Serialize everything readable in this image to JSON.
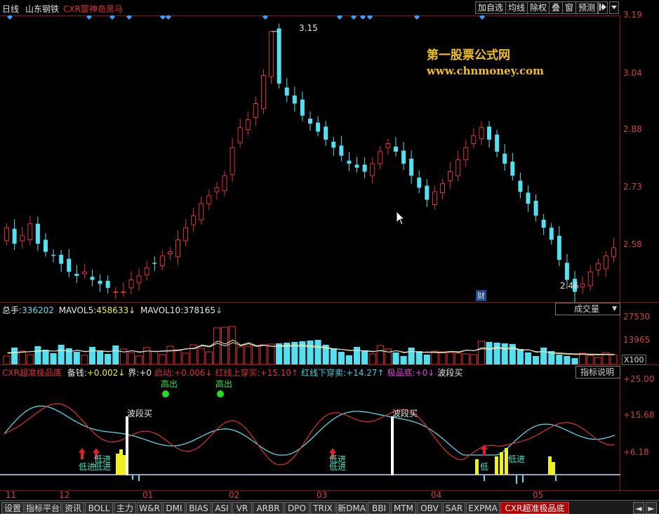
{
  "topbar": {
    "period": "日线",
    "stock_name": "山东钢铁",
    "formula_name": "CXR婴神奇黑马",
    "buttons": [
      "加自选",
      "均线",
      "除权",
      "叠",
      "窗",
      "预测"
    ],
    "nav_icon": "pipe-arrow-icon",
    "menu_icon": "menu-arrow-icon"
  },
  "watermark": {
    "title": "第一股票公式网",
    "url": "www.chnmoney.com"
  },
  "price_axis": [
    "3.19",
    "3.04",
    "2.88",
    "2.73",
    "2.58"
  ],
  "price_annotations": {
    "high": "3.15",
    "low": "2.46",
    "badge": "财"
  },
  "volume": {
    "label_total": "总手:",
    "total": "336202",
    "label_ma5": "MAVOL5:",
    "ma5": "458633",
    "label_ma10": "MAVOL10:",
    "ma10": "378165",
    "arrow": "↓",
    "selector": "成交量",
    "axis": [
      "27530",
      "13965"
    ],
    "multiplier": "X100"
  },
  "indicator": {
    "name": "CXR超准极品底",
    "items": [
      {
        "label": "备钱:",
        "value": "+0.002↓",
        "label_color": "#e8e8e8",
        "value_color": "#f0f020"
      },
      {
        "label": "界:",
        "value": "+0",
        "label_color": "#e8e8e8",
        "value_color": "#e8e8e8"
      },
      {
        "label": "启动:",
        "value": "+0.006↓",
        "label_color": "#e03030",
        "value_color": "#e03030"
      },
      {
        "label": "红线上穿买:",
        "value": "+15.10↑",
        "label_color": "#e03030",
        "value_color": "#e03030"
      },
      {
        "label": "红线下穿卖:",
        "value": "+14.27↑",
        "label_color": "#40d0e0",
        "value_color": "#40d0e0"
      },
      {
        "label": "极品底:",
        "value": "+0↓",
        "label_color": "#e040e0",
        "value_color": "#e040e0"
      },
      {
        "label": "波段买",
        "value": "",
        "label_color": "#e8e8e8",
        "value_color": "#e8e8e8"
      }
    ],
    "help_button": "指标说明",
    "axis": [
      "+25.00",
      "+15.68",
      "+6.18"
    ],
    "annotations": {
      "gao_chu": "高出",
      "bo_duan_mai": "波段买",
      "di_jin": "低进",
      "di_short": "低"
    }
  },
  "date_axis": [
    "11",
    "12",
    "01",
    "02",
    "03",
    "04",
    "05"
  ],
  "tabs": [
    "设置",
    "指标平台",
    "资讯",
    "BOLL",
    "主力",
    "W&R",
    "DMI",
    "BIAS",
    "ASI",
    "VR",
    "ARBR",
    "DPO",
    "TRIX",
    "新DMA",
    "BBI",
    "MTM",
    "OBV",
    "SAR",
    "EXPMA",
    "CXR超准极品底"
  ],
  "active_tab": "CXR超准极品底",
  "colors": {
    "up": "#e03030",
    "down": "#54e0f0",
    "grid": "#8a1010",
    "diamond": "#3aa0ff",
    "yellow": "#f0f020"
  },
  "chart_data": [
    {
      "type": "candlestick",
      "title": "",
      "ylim": [
        2.46,
        3.19
      ],
      "y_ticks": [
        2.58,
        2.73,
        2.88,
        3.04,
        3.19
      ],
      "x_ticks": [
        "11",
        "12",
        "01",
        "02",
        "03",
        "04",
        "05"
      ],
      "close_approx": [
        2.66,
        2.62,
        2.64,
        2.67,
        2.62,
        2.6,
        2.59,
        2.57,
        2.55,
        2.54,
        2.55,
        2.53,
        2.52,
        2.51,
        2.5,
        2.5,
        2.53,
        2.54,
        2.56,
        2.57,
        2.59,
        2.6,
        2.63,
        2.66,
        2.69,
        2.72,
        2.74,
        2.76,
        2.79,
        2.86,
        2.91,
        2.93,
        2.97,
        3.04,
        3.15,
        3.02,
        2.99,
        2.97,
        2.94,
        2.92,
        2.9,
        2.88,
        2.86,
        2.84,
        2.82,
        2.81,
        2.8,
        2.82,
        2.85,
        2.87,
        2.85,
        2.82,
        2.79,
        2.76,
        2.73,
        2.75,
        2.77,
        2.8,
        2.83,
        2.86,
        2.89,
        2.91,
        2.88,
        2.85,
        2.82,
        2.79,
        2.75,
        2.72,
        2.69,
        2.66,
        2.63,
        2.58,
        2.53,
        2.5,
        2.52,
        2.55,
        2.57,
        2.59,
        2.61
      ],
      "annotations": {
        "high": 3.15,
        "low": 2.46
      }
    },
    {
      "type": "bar",
      "title": "成交量",
      "y_ticks": [
        13965,
        27530
      ],
      "series": [
        {
          "name": "MAVOL5",
          "last": 458633
        },
        {
          "name": "MAVOL10",
          "last": 378165
        }
      ]
    },
    {
      "type": "line",
      "title": "CXR超准极品底",
      "y_ticks": [
        6.18,
        15.68,
        25.0
      ],
      "series": [
        {
          "name": "红线上穿买",
          "last": 15.1
        },
        {
          "name": "红线下穿卖",
          "last": 14.27
        }
      ]
    }
  ]
}
